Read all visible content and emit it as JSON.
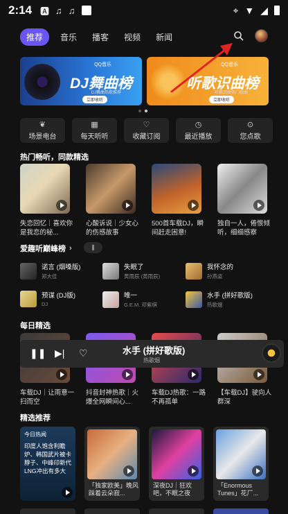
{
  "status": {
    "time": "2:14"
  },
  "tabs": [
    "推荐",
    "音乐",
    "播客",
    "视频",
    "新闻"
  ],
  "banners": [
    {
      "logo": "QQ音乐",
      "title": "DJ舞曲榜",
      "sub": "DJ舞曲热歌推荐",
      "btn": "立即收听"
    },
    {
      "logo": "QQ音乐",
      "title": "听歌识曲榜",
      "sub": "听歌识曲热门歌曲",
      "btn": "立即收听"
    }
  ],
  "quick": [
    {
      "icon": "leaf-icon",
      "label": "场景电台"
    },
    {
      "icon": "calendar-icon",
      "label": "每天听听"
    },
    {
      "icon": "heart-icon",
      "label": "收藏订阅"
    },
    {
      "icon": "clock-icon",
      "label": "最近播放"
    },
    {
      "icon": "dj-icon",
      "label": "您点歌"
    }
  ],
  "hot": {
    "title": "热门畅听，同款精选",
    "items": [
      {
        "cap": "失恋回忆｜喜欢你是我恋的秘..."
      },
      {
        "cap": "心酸诉说｜少女心的伤感故事"
      },
      {
        "cap": "500首车载DJ，瞬间赶走困意!"
      },
      {
        "cap": "独自一人，倦恨倾听，细细感察"
      }
    ]
  },
  "rank": {
    "title": "爱趣听巅峰榜",
    "items": [
      {
        "title": "诺言 (烟嗓版)",
        "artist": "郑大佳"
      },
      {
        "title": "失眠了",
        "artist": "黄雨辰 (黄雨辰)"
      },
      {
        "title": "我怀念的",
        "artist": "孙燕姿"
      },
      {
        "title": "预谋 (DJ版)",
        "artist": "DJ"
      },
      {
        "title": "唯一",
        "artist": "G.E.M. 邓紫棋"
      },
      {
        "title": "水手 (拼好歌版)",
        "artist": "热歌烟"
      }
    ]
  },
  "daily": {
    "title": "每日精选",
    "items": [
      {
        "cap": "车载DJ｜让雨意一扫而空"
      },
      {
        "cap": "抖音封神热歌｜火爆全网瞬间心..."
      },
      {
        "cap": "车载DJ热歌：一路不再孤单"
      },
      {
        "cap": "【车载DJ】驶向人群深"
      }
    ]
  },
  "player": {
    "title": "水手 (拼好歌版)",
    "artist": "热歌烟"
  },
  "picks": {
    "title": "精选推荐",
    "items": [
      {
        "tag": "今日热闻",
        "cap": "印度人饱含利瞻炉、韩国武片被卡脖子、中峰印新代LNG冲出有多大"
      },
      {
        "cap": "「独家欧美」晚风踩着云朵寂..."
      },
      {
        "cap": "深夜DJ｜狂欢吧，不眠之夜"
      },
      {
        "cap": "「Enormous Tunes」花厂..."
      }
    ]
  },
  "colors": {
    "accent": "#6a55f3",
    "arrow": "#e02424",
    "bg": "#121212"
  }
}
